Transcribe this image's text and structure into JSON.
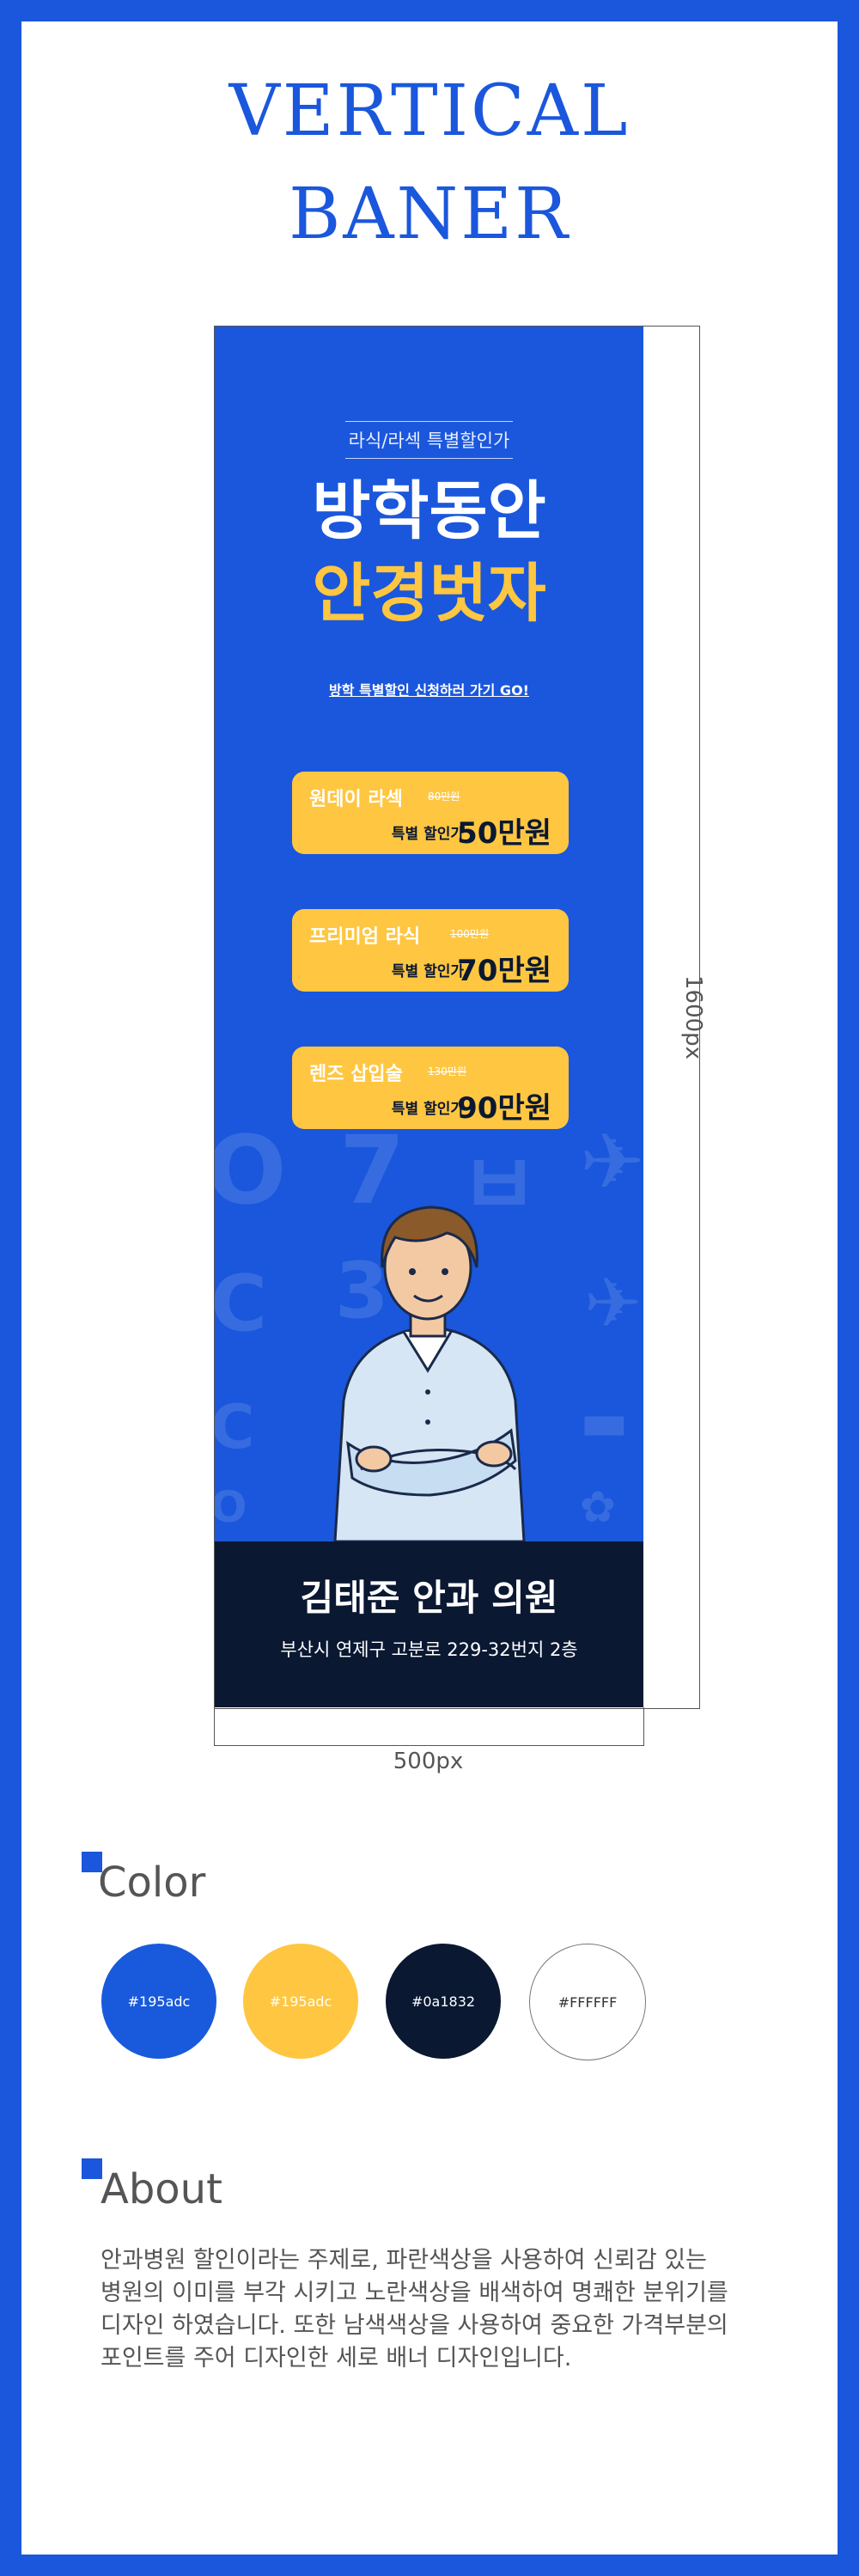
{
  "page": {
    "title_line1": "VERTICAL",
    "title_line2": "BANER"
  },
  "banner": {
    "subtitle": "라식/라섹 특별할인가",
    "headline1": "방학동안",
    "headline2": "안경벗자",
    "cta": "방학 특별할인 신청하러 가기 GO!",
    "offers": [
      {
        "name": "원데이 라섹",
        "old_price": "80만원",
        "label": "특별 할인가",
        "price": "50만원"
      },
      {
        "name": "프리미엄 라식",
        "old_price": "100만원",
        "label": "특별 할인가",
        "price": "70만원"
      },
      {
        "name": "렌즈 삽입술",
        "old_price": "130만원",
        "label": "특별 할인가",
        "price": "90만원"
      }
    ],
    "clinic": "김태준 안과 의원",
    "address": "부산시 연제구 고분로 229-32번지 2층",
    "height_label": "1600px",
    "width_label": "500px"
  },
  "color_section": {
    "title": "Color",
    "swatches": [
      {
        "label": "#195adc",
        "fill": "#195adc",
        "text": "#ffffff"
      },
      {
        "label": "#195adc",
        "fill": "#ffc641",
        "text": "#ffffff"
      },
      {
        "label": "#0a1832",
        "fill": "#0a1832",
        "text": "#ffffff"
      },
      {
        "label": "#FFFFFF",
        "fill": "#ffffff",
        "text": "#333333"
      }
    ]
  },
  "about_section": {
    "title": "About",
    "lines": [
      "안과병원 할인이라는 주제로, 파란색상을 사용하여 신뢰감 있는",
      "병원의 이미를 부각 시키고 노란색상을 배색하여 명쾌한 분위기를",
      "디자인 하였습니다. 또한 남색색상을 사용하여 중요한 가격부분의",
      "포인트를 주어 디자인한 세로 배너 디자인입니다."
    ]
  },
  "colors": {
    "accent": "#1a57dc",
    "yellow": "#ffc641",
    "navy": "#0a1832"
  }
}
